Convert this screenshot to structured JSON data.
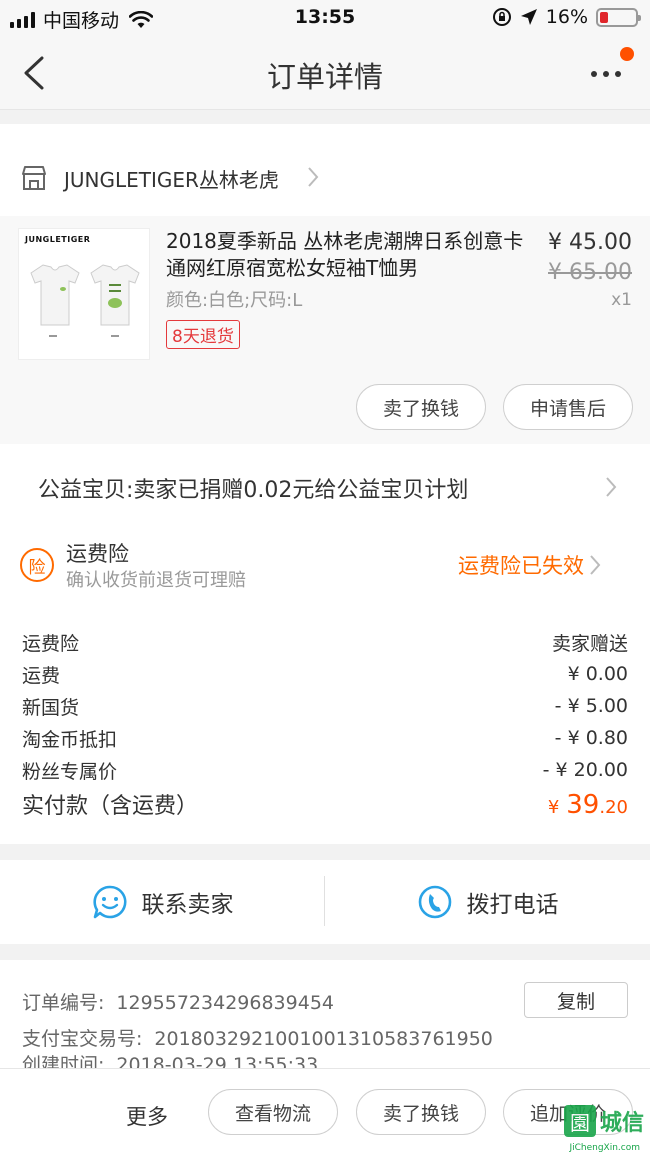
{
  "status_bar": {
    "carrier": "中国移动",
    "time": "13:55",
    "battery": "16%"
  },
  "nav": {
    "title": "订单详情"
  },
  "shop": {
    "name": "JUNGLETIGER丛林老虎"
  },
  "item": {
    "thumb_brand": "JUNGLETIGER",
    "title": "2018夏季新品 丛林老虎潮牌日系创意卡通网红原宿宽松女短袖T恤男",
    "sku": "颜色:白色;尺码:L",
    "tag": "8天退货",
    "price": "¥ 45.00",
    "original_price": "¥ 65.00",
    "quantity": "x1",
    "sell_button": "卖了换钱",
    "after_sale_button": "申请售后"
  },
  "charity": {
    "text": "公益宝贝:卖家已捐赠0.02元给公益宝贝计划"
  },
  "insurance": {
    "icon_char": "险",
    "title": "运费险",
    "subtitle": "确认收货前退货可理赔",
    "status": "运费险已失效"
  },
  "fees": {
    "rows": [
      {
        "label": "运费险",
        "value": "卖家赠送"
      },
      {
        "label": "运费",
        "value": "¥ 0.00"
      },
      {
        "label": "新国货",
        "value": "- ¥ 5.00"
      },
      {
        "label": "淘金币抵扣",
        "value": "- ¥ 0.80"
      },
      {
        "label": "粉丝专属价",
        "value": "- ¥ 20.00"
      }
    ],
    "total_label": "实付款（含运费）",
    "total_currency": "¥",
    "total_int": "39",
    "total_dec": ".20"
  },
  "contact": {
    "seller_label": "联系卖家",
    "phone_label": "拨打电话"
  },
  "order_info": {
    "order_no_label": "订单编号:",
    "order_no": "129557234296839454",
    "copy_button": "复制",
    "alipay_label": "支付宝交易号:",
    "alipay_no": "2018032921001001310583761950",
    "created_label": "创建时间:",
    "created_time": "2018-03-29 13:55:33"
  },
  "bottom_bar": {
    "more": "更多",
    "logistics_button": "查看物流",
    "sell_button": "卖了换钱",
    "review_button": "追加评价"
  },
  "watermark": {
    "icon_char": "園",
    "text": "城信",
    "domain": "JiChengXin.com"
  },
  "colors": {
    "accent": "#ff5000",
    "insurance": "#ff6a00",
    "tag_red": "#e4393c",
    "link_blue": "#2aa3e6"
  }
}
